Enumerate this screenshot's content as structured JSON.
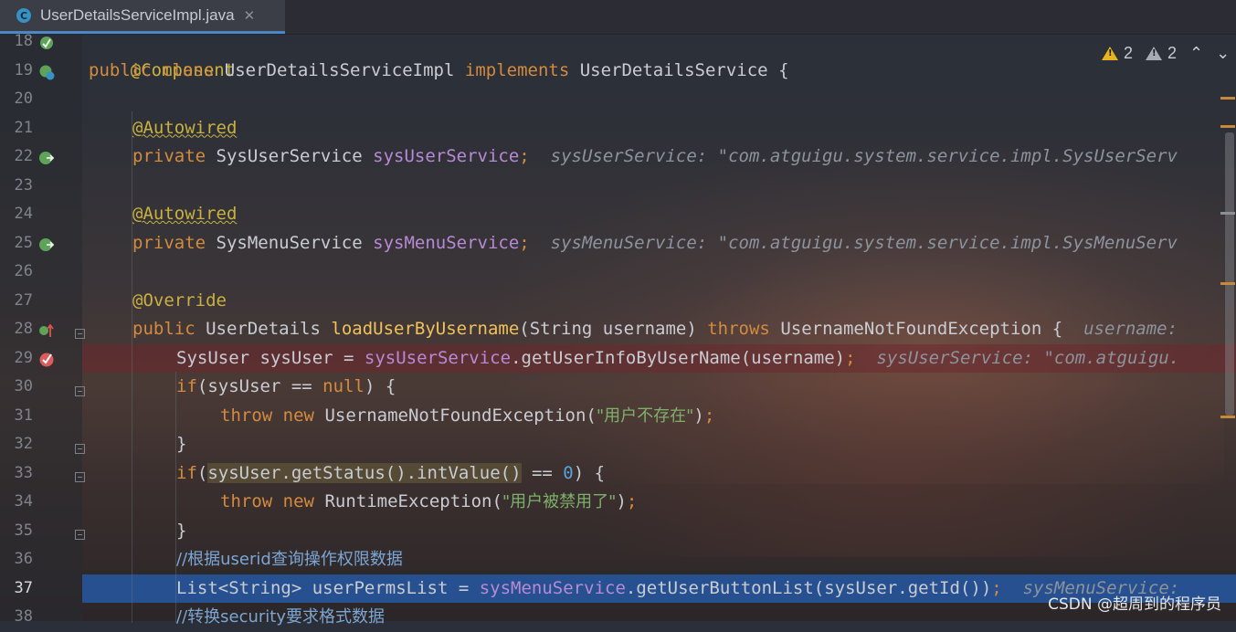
{
  "tab": {
    "title": "UserDetailsServiceImpl.java",
    "icon": "C",
    "close": "✕"
  },
  "inspections": {
    "warnings": "2",
    "weak_warnings": "2",
    "up": "⌃",
    "down": "⌄"
  },
  "lines": [
    {
      "n": "18"
    },
    {
      "n": "19"
    },
    {
      "n": "20"
    },
    {
      "n": "21"
    },
    {
      "n": "22"
    },
    {
      "n": "23"
    },
    {
      "n": "24"
    },
    {
      "n": "25"
    },
    {
      "n": "26"
    },
    {
      "n": "27"
    },
    {
      "n": "28"
    },
    {
      "n": "29"
    },
    {
      "n": "30"
    },
    {
      "n": "31"
    },
    {
      "n": "32"
    },
    {
      "n": "33"
    },
    {
      "n": "34"
    },
    {
      "n": "35"
    },
    {
      "n": "36"
    },
    {
      "n": "37"
    },
    {
      "n": "38"
    }
  ],
  "code": {
    "l18": {
      "ann": "@Component"
    },
    "l19": {
      "kw1": "public",
      "kw2": "class",
      "name": "UserDetailsServiceImpl",
      "kw3": "implements",
      "iface": "UserDetailsService",
      "brace": "{"
    },
    "l21": {
      "ann": "@Autowired"
    },
    "l22": {
      "kw": "private",
      "type": "SysUserService",
      "field": "sysUserService",
      "semi": ";",
      "hint": "sysUserService: \"com.atguigu.system.service.impl.SysUserServ"
    },
    "l24": {
      "ann": "@Autowired"
    },
    "l25": {
      "kw": "private",
      "type": "SysMenuService",
      "field": "sysMenuService",
      "semi": ";",
      "hint": "sysMenuService: \"com.atguigu.system.service.impl.SysMenuServ"
    },
    "l27": {
      "ann": "@Override"
    },
    "l28": {
      "kw": "public",
      "type": "UserDetails",
      "fn": "loadUserByUsername",
      "params": "(String username)",
      "throws": "throws",
      "exc": "UsernameNotFoundException {",
      "hint": "username:"
    },
    "l29": {
      "pre": "SysUser sysUser = ",
      "field": "sysUserService",
      "call": ".getUserInfoByUserName(username)",
      "semi": ";",
      "hint": "sysUserService: \"com.atguigu."
    },
    "l30": {
      "kw": "if",
      "pre": "(sysUser == ",
      "kw2": "null",
      "post": ") {"
    },
    "l31": {
      "kw1": "throw",
      "kw2": "new",
      "exc": "UsernameNotFoundException(",
      "str": "\"用户不存在\"",
      "post": ")",
      "semi": ";"
    },
    "l32": {
      "text": "}"
    },
    "l33": {
      "kw": "if",
      "open": "(",
      "hl": "sysUser.getStatus().intValue()",
      "mid": " == ",
      "num": "0",
      "post": ") {"
    },
    "l34": {
      "kw1": "throw",
      "kw2": "new",
      "exc": "RuntimeException(",
      "str": "\"用户被禁用了\"",
      "post": ")",
      "semi": ";"
    },
    "l35": {
      "text": "}"
    },
    "l36": {
      "cmt": "//根据userid查询操作权限数据"
    },
    "l37": {
      "pre": "List<String> userPermsList = ",
      "field": "sysMenuService",
      "call": ".getUserButtonList(sysUser.getId())",
      "semi": ";",
      "hint": "sysMenuService:"
    },
    "l38": {
      "cmt": "//转换security要求格式数据"
    }
  },
  "watermark": "CSDN @超周到的程序员"
}
